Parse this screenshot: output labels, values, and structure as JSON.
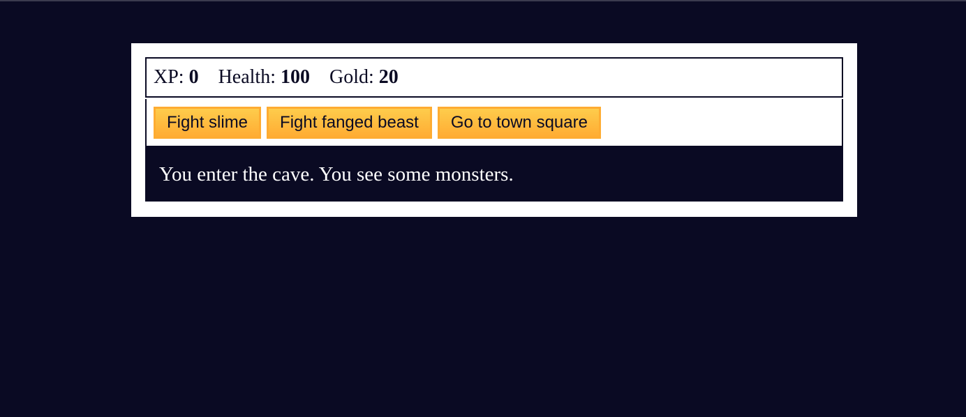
{
  "stats": {
    "xp_label": "XP:",
    "xp_value": "0",
    "health_label": "Health:",
    "health_value": "100",
    "gold_label": "Gold:",
    "gold_value": "20"
  },
  "controls": {
    "button1": "Fight slime",
    "button2": "Fight fanged beast",
    "button3": "Go to town square"
  },
  "text": {
    "message": "You enter the cave. You see some monsters."
  },
  "colors": {
    "background": "#0a0a23",
    "button_gradient_top": "#fecc4c",
    "button_gradient_bottom": "#ffac33",
    "button_border": "#feac32",
    "panel": "#ffffff"
  }
}
